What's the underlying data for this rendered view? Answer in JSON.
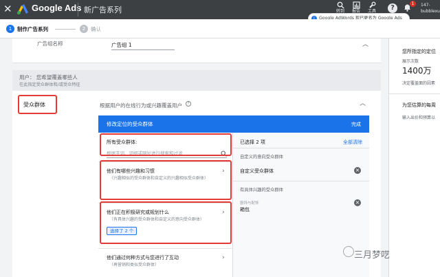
{
  "app": {
    "brand": "Google Ads",
    "campaign_title": "新广告系列"
  },
  "toolbar": {
    "tools": [
      {
        "label": "转到",
        "icon": "search-icon"
      },
      {
        "label": "报告",
        "icon": "report-icon"
      },
      {
        "label": "工具",
        "icon": "wrench-icon"
      }
    ],
    "help": "?",
    "notification_count": "1",
    "account_line1": "147-",
    "account_line2": "bubblexu"
  },
  "tooltip": {
    "text": "Google AdWords 现已更名为 Google Ads"
  },
  "stepper": {
    "steps": [
      {
        "num": "1",
        "label": "制作广告系列",
        "active": true
      },
      {
        "num": "2",
        "label": "确认",
        "active": false
      }
    ]
  },
  "adgroup": {
    "label": "广告组名称",
    "value": "广告组 1"
  },
  "users_section": {
    "title": "用户： 您希望覆盖哪些人",
    "subtitle": "在此指定受众群体和/或受众特征"
  },
  "audience": {
    "label": "受众群体",
    "description": "根据用户的在线行为或兴趣覆盖用户",
    "help": "?",
    "editor": {
      "title": "修改定位的受众群体",
      "done": "完成",
      "search_label": "所有受众群体:",
      "search_placeholder": "根据字词、词组或网址进行搜索和过滤",
      "categories": [
        {
          "title": "他们有哪些兴趣和习惯",
          "subtitle": "（兴趣相似的受众群体和自定义的兴趣相似受众群体）"
        },
        {
          "title": "他们正在积极研究或规划什么",
          "subtitle": "（有具体兴趣的受众群体和自定义的意向受众群体）",
          "chip": "选择了 2 个"
        },
        {
          "title": "他们通过何种方式与您进行了互动",
          "subtitle": "（再营销和类似受众群体）"
        }
      ],
      "selected": {
        "count": "已选择 2 项",
        "clear": "全部清除",
        "sections": [
          {
            "title": "自定义的意向受众群体",
            "item": "自定义受众群体"
          },
          {
            "title": "有具体兴趣的受众群体",
            "caption": "服饰与配饰",
            "item": "箱包"
          }
        ]
      }
    }
  },
  "right_panel": {
    "title": "您所指定的定位",
    "impressions_label": "展示次数",
    "impressions_value": "1400万",
    "note": "决定覆盖面的因素",
    "estimate_title": "为您估算的每周",
    "estimate_note": "输入出价和预算以"
  },
  "watermark": {
    "text": "三月梦呓"
  }
}
